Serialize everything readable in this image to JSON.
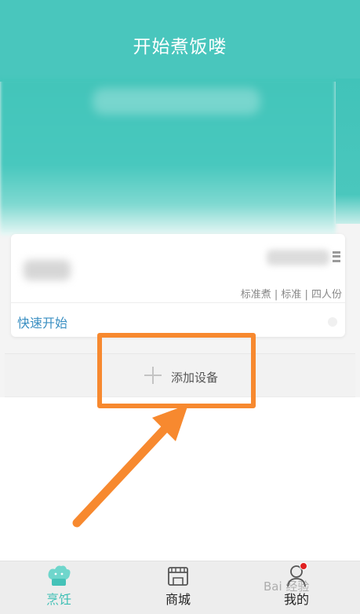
{
  "header": {
    "title": "开始煮饭喽"
  },
  "device_card": {
    "status_text": "标准煮 | 标准 | 四人份",
    "quick_start_label": "快速开始"
  },
  "add_device": {
    "label": "添加设备"
  },
  "tabbar": {
    "items": [
      {
        "label": "烹饪",
        "icon": "chef-hat-icon",
        "active": true
      },
      {
        "label": "商城",
        "icon": "store-icon",
        "active": false
      },
      {
        "label": "我的",
        "icon": "profile-icon",
        "active": false
      }
    ]
  },
  "colors": {
    "brand": "#49c6bd",
    "annotation": "#f7892f",
    "link": "#3a8fc2",
    "badge": "#e02020"
  }
}
